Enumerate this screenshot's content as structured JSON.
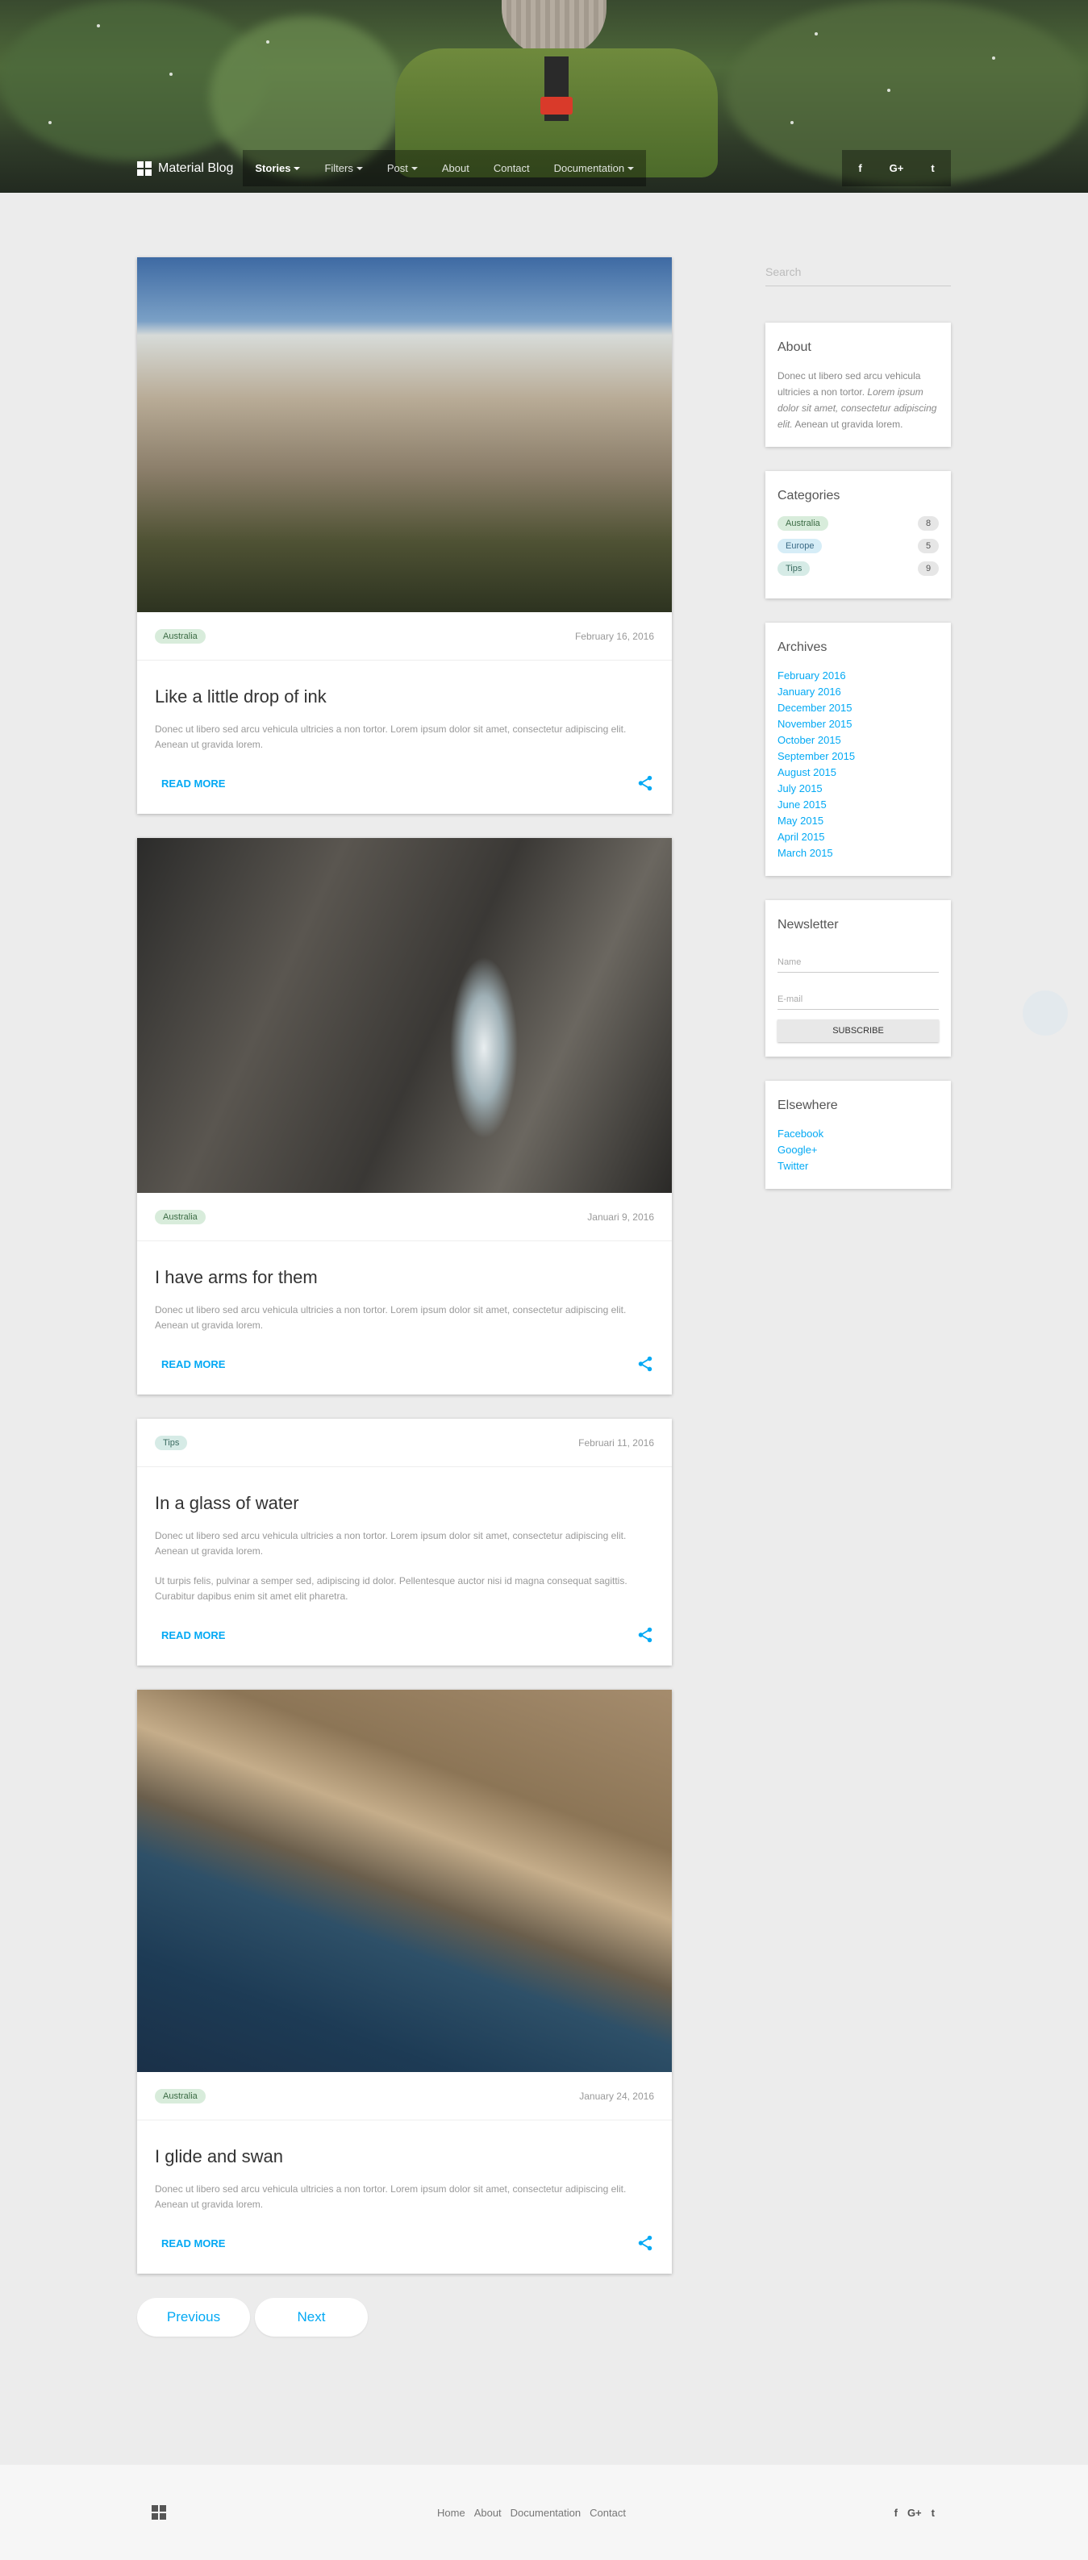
{
  "nav": {
    "brand": "Material Blog",
    "links": [
      {
        "label": "Stories",
        "dropdown": true,
        "active": true
      },
      {
        "label": "Filters",
        "dropdown": true
      },
      {
        "label": "Post",
        "dropdown": true
      },
      {
        "label": "About"
      },
      {
        "label": "Contact"
      },
      {
        "label": "Documentation",
        "dropdown": true
      }
    ],
    "social": [
      "f",
      "G+",
      "t"
    ]
  },
  "posts": [
    {
      "tag": "Australia",
      "date": "February 16, 2016",
      "title": "Like a little drop of ink",
      "paragraphs": [
        "Donec ut libero sed arcu vehicula ultricies a non tortor. Lorem ipsum dolor sit amet, consectetur adipiscing elit. Aenean ut gravida lorem."
      ],
      "read_more": "READ MORE",
      "image": "mountain-valley"
    },
    {
      "tag": "Australia",
      "date": "Januari 9, 2016",
      "title": "I have arms for them",
      "paragraphs": [
        "Donec ut libero sed arcu vehicula ultricies a non tortor. Lorem ipsum dolor sit amet, consectetur adipiscing elit. Aenean ut gravida lorem."
      ],
      "read_more": "READ MORE",
      "image": "river-canyon"
    },
    {
      "tag": "Tips",
      "date": "Februari 11, 2016",
      "title": "In a glass of water",
      "paragraphs": [
        "Donec ut libero sed arcu vehicula ultricies a non tortor. Lorem ipsum dolor sit amet, consectetur adipiscing elit. Aenean ut gravida lorem.",
        "Ut turpis felis, pulvinar a semper sed, adipiscing id dolor. Pellentesque auctor nisi id magna consequat sagittis. Curabitur dapibus enim sit amet elit pharetra."
      ],
      "read_more": "READ MORE",
      "image": null
    },
    {
      "tag": "Australia",
      "date": "January 24, 2016",
      "title": "I glide and swan",
      "paragraphs": [
        "Donec ut libero sed arcu vehicula ultricies a non tortor. Lorem ipsum dolor sit amet, consectetur adipiscing elit. Aenean ut gravida lorem."
      ],
      "read_more": "READ MORE",
      "image": "rocky-coast"
    }
  ],
  "pager": {
    "previous": "Previous",
    "next": "Next"
  },
  "sidebar": {
    "search_placeholder": "Search",
    "about": {
      "title": "About",
      "text_plain": "Donec ut libero sed arcu vehicula ultricies a non tortor. ",
      "text_italic": "Lorem ipsum dolor sit amet, consectetur adipiscing elit.",
      "text_end": " Aenean ut gravida lorem."
    },
    "categories": {
      "title": "Categories",
      "items": [
        {
          "label": "Australia",
          "count": "8",
          "color": "green"
        },
        {
          "label": "Europe",
          "count": "5",
          "color": "blue"
        },
        {
          "label": "Tips",
          "count": "9",
          "color": "teal"
        }
      ]
    },
    "archives": {
      "title": "Archives",
      "items": [
        "February 2016",
        "January 2016",
        "December 2015",
        "November 2015",
        "October 2015",
        "September 2015",
        "August 2015",
        "July 2015",
        "June 2015",
        "May 2015",
        "April 2015",
        "March 2015"
      ]
    },
    "newsletter": {
      "title": "Newsletter",
      "name_placeholder": "Name",
      "email_placeholder": "E-mail",
      "button": "SUBSCRIBE"
    },
    "elsewhere": {
      "title": "Elsewhere",
      "items": [
        "Facebook",
        "Google+",
        "Twitter"
      ]
    }
  },
  "footer": {
    "links": [
      "Home",
      "About",
      "Documentation",
      "Contact"
    ],
    "social": [
      "f",
      "G+",
      "t"
    ]
  },
  "colors": {
    "accent": "#03a9f4",
    "background": "#ececec"
  }
}
